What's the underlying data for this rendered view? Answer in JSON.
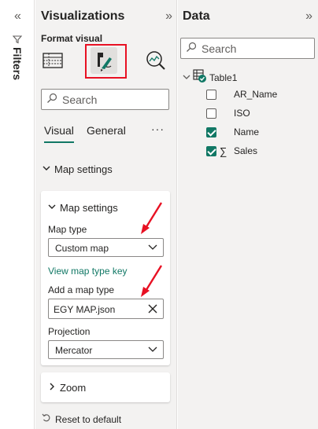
{
  "filters": {
    "collapse_glyph": "«",
    "label": "Filters",
    "icon": "filter-icon"
  },
  "visualizations": {
    "title": "Visualizations",
    "expand_glyph": "»",
    "subtitle": "Format visual",
    "icons": [
      "table-build-icon",
      "paintbrush-format-icon",
      "analytics-magnifier-icon"
    ],
    "search_placeholder": "Search",
    "tabs": [
      {
        "label": "Visual",
        "active": true
      },
      {
        "label": "General",
        "active": false
      }
    ],
    "more_label": "···",
    "section_title": "Map settings",
    "map_card": {
      "title": "Map settings",
      "map_type_label": "Map type",
      "map_type_value": "Custom map",
      "link": "View map type key",
      "add_label": "Add a map type",
      "file_value": "EGY MAP.json",
      "projection_label": "Projection",
      "projection_value": "Mercator"
    },
    "zoom_card": {
      "title": "Zoom"
    },
    "reset_label": "Reset to default"
  },
  "data": {
    "title": "Data",
    "expand_glyph": "»",
    "search_placeholder": "Search",
    "table": "Table1",
    "fields": [
      {
        "name": "AR_Name",
        "checked": false,
        "sigma": false
      },
      {
        "name": "ISO",
        "checked": false,
        "sigma": false
      },
      {
        "name": "Name",
        "checked": true,
        "sigma": false
      },
      {
        "name": "Sales",
        "checked": true,
        "sigma": true
      }
    ],
    "sigma_glyph": "∑"
  },
  "colors": {
    "accent": "#117865",
    "annotation": "#e81123",
    "pane_bg": "#f3f2f1"
  }
}
